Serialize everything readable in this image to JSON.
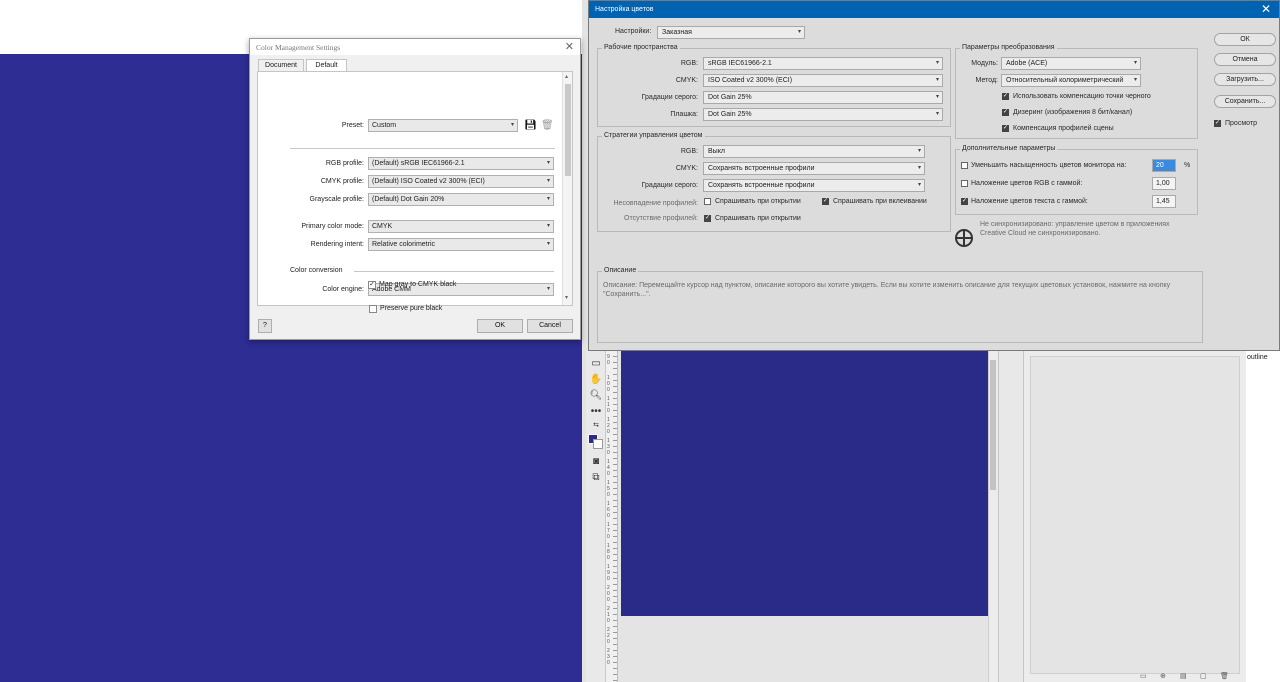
{
  "cms_dialog": {
    "title": "Color Management Settings",
    "close_icon": "close-icon",
    "tabs": [
      "Document",
      "Default"
    ],
    "preset": {
      "label": "Preset:",
      "value": "Custom"
    },
    "rgb_profile": {
      "label": "RGB profile:",
      "value": "(Default) sRGB IEC61966-2.1"
    },
    "cmyk_profile": {
      "label": "CMYK profile:",
      "value": "(Default) ISO Coated v2 300% (ECI)"
    },
    "grayscale_profile": {
      "label": "Grayscale profile:",
      "value": "(Default) Dot Gain 20%"
    },
    "primary_color_mode": {
      "label": "Primary color mode:",
      "value": "CMYK"
    },
    "rendering_intent": {
      "label": "Rendering intent:",
      "value": "Relative colorimetric"
    },
    "color_conversion_heading": "Color conversion",
    "color_engine": {
      "label": "Color engine:",
      "value": "Adobe CMM"
    },
    "preserve_pure_black": {
      "label": "Preserve pure black",
      "checked": false
    },
    "map_gray": {
      "label": "Map gray to CMYK black",
      "checked": true
    },
    "help_label": "?",
    "ok_label": "OK",
    "cancel_label": "Cancel"
  },
  "ps_dialog": {
    "title": "Настройка цветов",
    "settings": {
      "label": "Настройки:",
      "value": "Заказная"
    },
    "working_spaces": {
      "title": "Рабочие пространства",
      "rgb": {
        "label": "RGB:",
        "value": "sRGB IEC61966-2.1"
      },
      "cmyk": {
        "label": "CMYK:",
        "value": "ISO Coated v2 300% (ECI)"
      },
      "gray": {
        "label": "Градации серого:",
        "value": "Dot Gain 25%"
      },
      "spot": {
        "label": "Плашка:",
        "value": "Dot Gain 25%"
      }
    },
    "policies": {
      "title": "Стратегии управления цветом",
      "rgb": {
        "label": "RGB:",
        "value": "Выкл"
      },
      "cmyk": {
        "label": "CMYK:",
        "value": "Сохранять встроенные профили"
      },
      "gray": {
        "label": "Градации серого:",
        "value": "Сохранять встроенные профили"
      },
      "mismatch_label": "Несовпадение профилей:",
      "ask_open": "Спрашивать при открытии",
      "ask_paste": "Спрашивать при вклеивании",
      "missing_label": "Отсутствие профилей:",
      "ask_open_missing": "Спрашивать при открытии"
    },
    "conversion": {
      "title": "Параметры преобразования",
      "engine": {
        "label": "Модуль:",
        "value": "Adobe (ACE)"
      },
      "intent": {
        "label": "Метод:",
        "value": "Относительный колориметрический"
      },
      "bpc": "Использовать компенсацию точки черного",
      "dither": "Дизеринг (изображения 8 бит/канал)",
      "scene": "Компенсация профилей сцены"
    },
    "advanced": {
      "title": "Дополнительные параметры",
      "desaturate": {
        "label": "Уменьшить насыщенность цветов монитора на:",
        "value": "20",
        "unit": "%"
      },
      "blend_rgb": {
        "label": "Наложение цветов RGB с гаммой:",
        "value": "1,00"
      },
      "blend_text": {
        "label": "Наложение цветов текста с гаммой:",
        "value": "1,45"
      },
      "sync_line1": "Не синхронизировано: управление цветом в приложениях",
      "sync_line2": "Creative Cloud не синхронизировано."
    },
    "description": {
      "title": "Описание",
      "text": "Описание:  Перемещайте курсор над пунктом, описание которого вы хотите увидеть.  Если вы хотите изменить описание для текущих цветовых установок, нажмите на кнопку \"Сохранить...\"."
    },
    "buttons": {
      "ok": "ОК",
      "cancel": "Отмена",
      "load": "Загрузить...",
      "save": "Сохранить..."
    },
    "preview": {
      "label": "Просмотр",
      "checked": true
    }
  },
  "workspace": {
    "outline_label": "outline",
    "ruler_labels": [
      "9\n0",
      "1\n0\n0",
      "1\n1\n0",
      "1\n2\n0",
      "1\n3\n0",
      "1\n4\n0",
      "1\n5\n0",
      "1\n6\n0",
      "1\n7\n0",
      "1\n8\n0",
      "1\n9\n0",
      "2\n0\n0",
      "2\n1\n0",
      "2\n2\n0",
      "2\n3\n0"
    ]
  },
  "colors": {
    "blue_background": "#2d2d93",
    "canvas": "#2a2a88",
    "titlebar": "#0063b1"
  }
}
